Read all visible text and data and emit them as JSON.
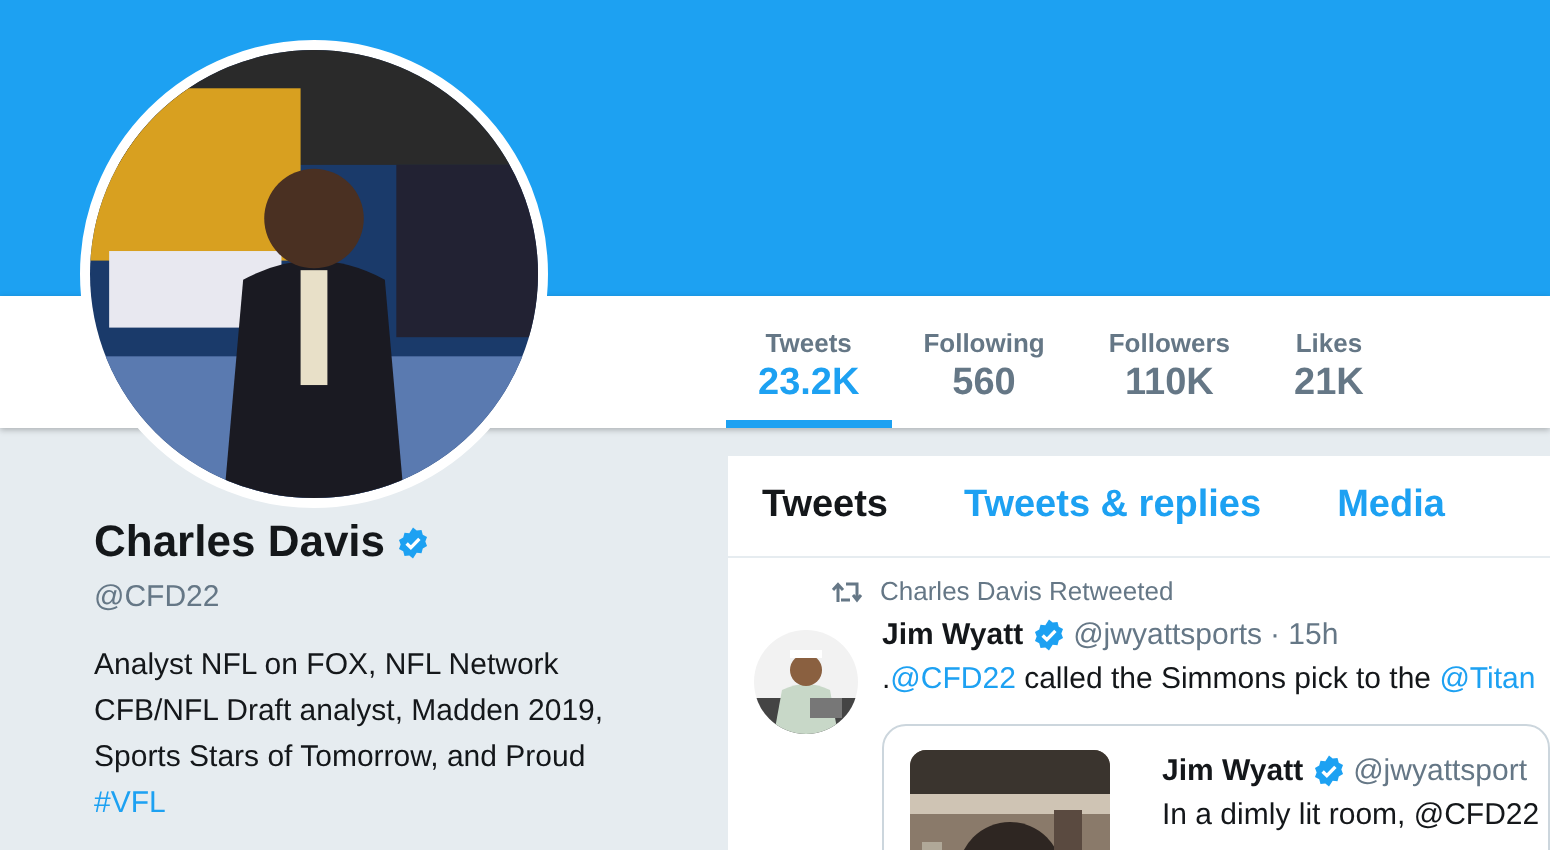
{
  "profile": {
    "name": "Charles Davis",
    "verified": true,
    "handle": "@CFD22",
    "bio": [
      {
        "text": "Analyst NFL on FOX, NFL Network CFB/NFL Draft analyst, Madden 2019, Sports Stars of Tomorrow, and Proud ",
        "link": false
      },
      {
        "text": "#VFL",
        "link": true
      }
    ]
  },
  "stats": [
    {
      "label": "Tweets",
      "value": "23.2K",
      "selected": true
    },
    {
      "label": "Following",
      "value": "560",
      "selected": false
    },
    {
      "label": "Followers",
      "value": "110K",
      "selected": false
    },
    {
      "label": "Likes",
      "value": "21K",
      "selected": false
    }
  ],
  "tabs": [
    {
      "label": "Tweets",
      "selected": true
    },
    {
      "label": "Tweets & replies",
      "selected": false
    },
    {
      "label": "Media",
      "selected": false
    }
  ],
  "tweet": {
    "retweeted_by": "Charles Davis Retweeted",
    "author": "Jim Wyatt",
    "verified": true,
    "handle": "@jwyattsports",
    "time": "· 15h",
    "text": [
      {
        "text": ".",
        "link": false
      },
      {
        "text": "@CFD22",
        "link": true
      },
      {
        "text": " called the Simmons pick to the ",
        "link": false
      },
      {
        "text": "@Titan",
        "link": true
      }
    ],
    "quote": {
      "author": "Jim Wyatt",
      "verified": true,
      "handle": "@jwyattsport",
      "text": "In a dimly lit room, @CFD22"
    }
  }
}
